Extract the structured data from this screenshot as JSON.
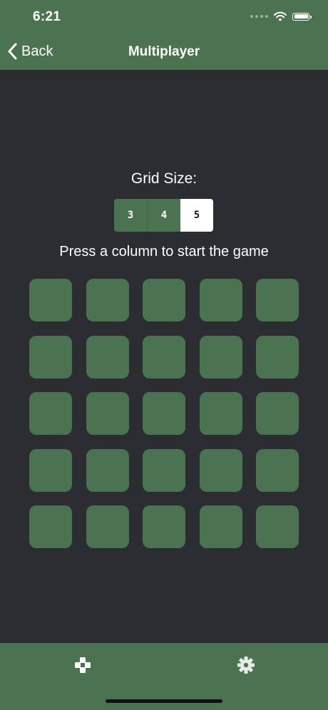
{
  "status_bar": {
    "time": "6:21"
  },
  "nav": {
    "back_label": "Back",
    "title": "Multiplayer"
  },
  "grid_size": {
    "label": "Grid Size:",
    "options": [
      "3",
      "4",
      "5"
    ],
    "selected": "5"
  },
  "instruction": "Press a column to start the game",
  "board": {
    "rows": 5,
    "columns": 5
  },
  "tabs": [
    {
      "icon": "gamepad-icon"
    },
    {
      "icon": "gear-icon"
    }
  ],
  "colors": {
    "accent": "#4b7352",
    "background": "#2b2d33",
    "selected_segment": "#ffffff"
  }
}
